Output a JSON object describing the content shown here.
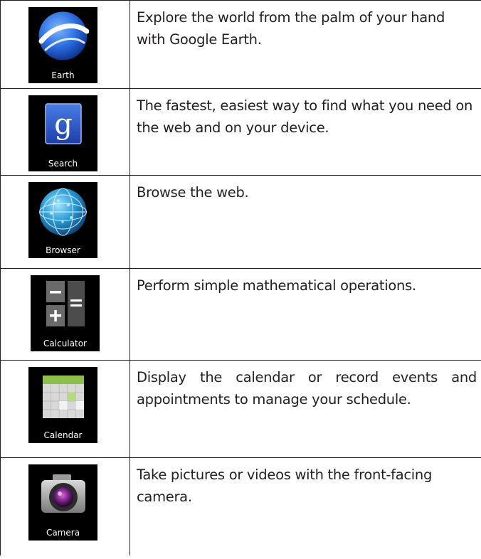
{
  "apps": [
    {
      "label": "Earth",
      "icon": "google-earth-icon",
      "description": "Explore the world from the palm of your hand with Google Earth."
    },
    {
      "label": "Search",
      "icon": "google-search-icon",
      "description": "The fastest, easiest way to find what you need on the web and on your device."
    },
    {
      "label": "Browser",
      "icon": "browser-globe-icon",
      "description": "Browse the web."
    },
    {
      "label": "Calculator",
      "icon": "calculator-icon",
      "description": "Perform simple mathematical operations."
    },
    {
      "label": "Calendar",
      "icon": "calendar-icon",
      "description": "Display the calendar or record events and appointments to manage your schedule."
    },
    {
      "label": "Camera",
      "icon": "camera-icon",
      "description": "Take pictures or videos with the front-facing camera."
    }
  ],
  "colors": {
    "border": "#231f20",
    "icon_background": "#000000",
    "text": "#231f20"
  }
}
